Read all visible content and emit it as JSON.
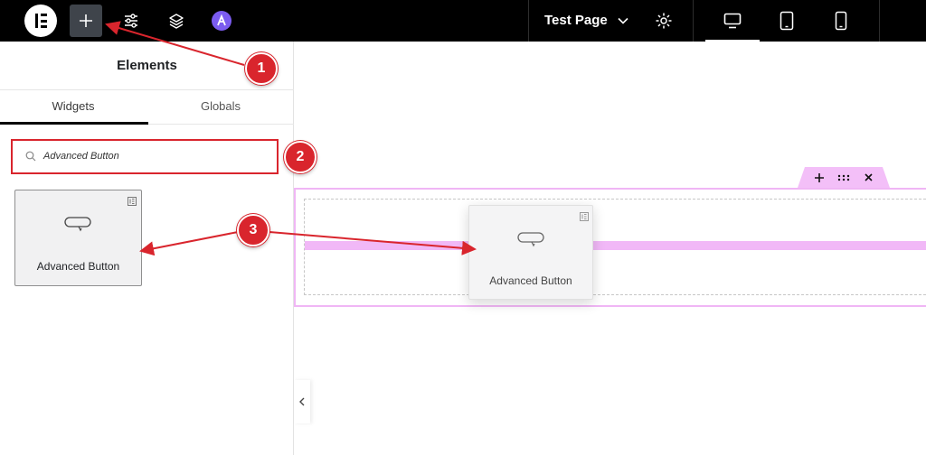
{
  "topbar": {
    "page_title": "Test Page",
    "icons": [
      "elementor-logo-icon",
      "plus-icon",
      "settings-sliders-icon",
      "layers-icon",
      "addon-logo-icon",
      "chevron-down-icon",
      "gear-icon",
      "desktop-icon",
      "tablet-icon",
      "mobile-icon"
    ],
    "accent_addon": "#7b5cf0"
  },
  "panel": {
    "title": "Elements",
    "tabs": [
      {
        "label": "Widgets",
        "active": true
      },
      {
        "label": "Globals",
        "active": false
      }
    ],
    "search": {
      "value": "Advanced Button"
    },
    "widgets": [
      {
        "label": "Advanced Button",
        "icon": "button-icon",
        "badge": "pro-badge-icon"
      }
    ]
  },
  "canvas": {
    "section_handle_icons": [
      "plus-icon",
      "drag-grid-icon",
      "close-icon"
    ],
    "dragging_widget": {
      "label": "Advanced Button",
      "icon": "button-icon"
    },
    "highlight_color": "#f3bff8"
  },
  "annotations": {
    "callouts": [
      "1",
      "2",
      "3"
    ],
    "color": "#d9252d"
  }
}
